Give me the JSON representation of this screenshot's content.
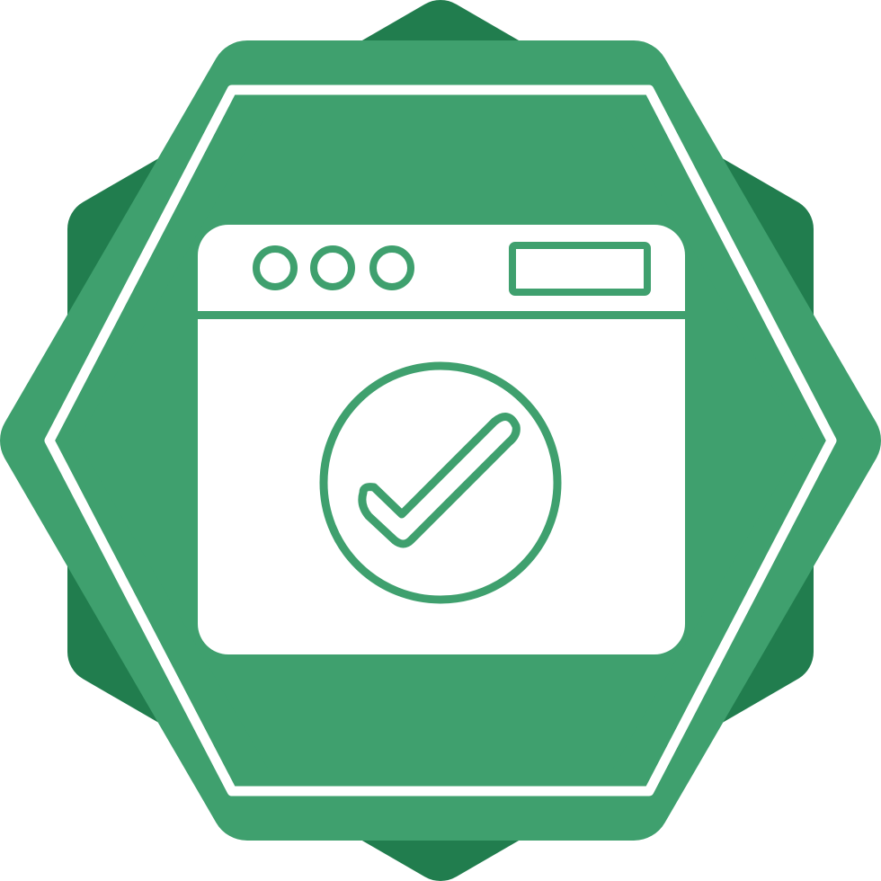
{
  "icon": {
    "name": "browser-window-check-badge",
    "colors": {
      "back_layer": "#217d4e",
      "front_layer": "#3fa06e",
      "outline": "#ffffff",
      "window": "#ffffff"
    },
    "window_buttons_count": 3,
    "glyphs": [
      "browser-window-icon",
      "check-circle-icon"
    ]
  }
}
